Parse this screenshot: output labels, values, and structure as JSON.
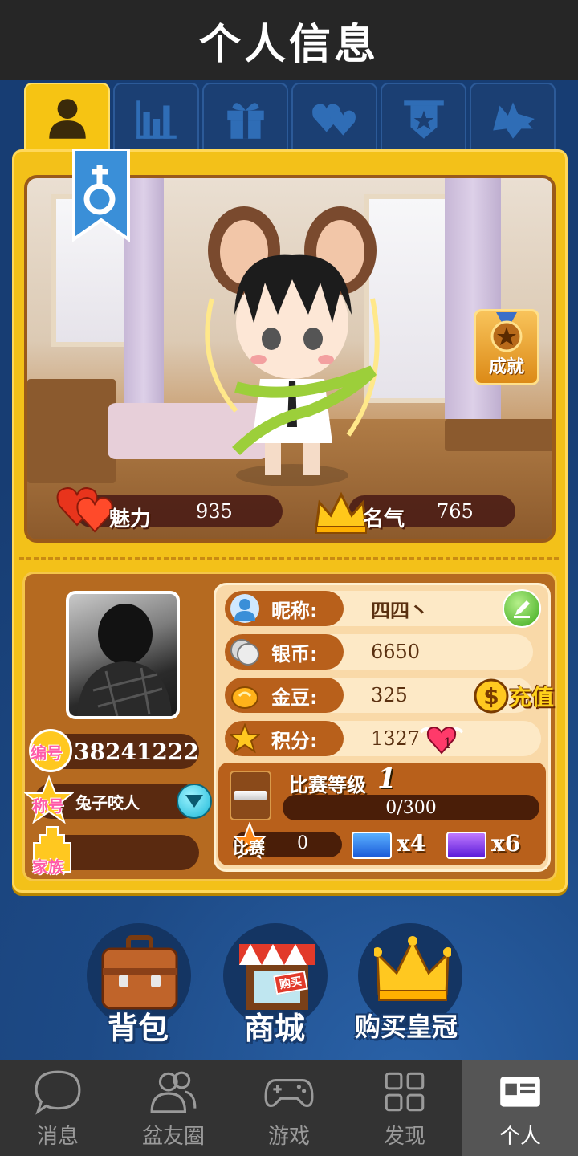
{
  "header": {
    "title": "个人信息"
  },
  "tabs": [
    {
      "icon": "person-icon",
      "active": true
    },
    {
      "icon": "bar-chart-icon",
      "active": false
    },
    {
      "icon": "gift-icon",
      "active": false
    },
    {
      "icon": "hearts-icon",
      "active": false
    },
    {
      "icon": "shield-star-icon",
      "active": false
    },
    {
      "icon": "wolf-icon",
      "active": false
    }
  ],
  "profile": {
    "gender": "male",
    "achievement_label": "成就",
    "charm_label": "魅力",
    "charm_value": "935",
    "fame_label": "名气",
    "fame_value": "765"
  },
  "identity": {
    "id_badge": "编号",
    "id_value": "38241222",
    "title_badge": "称号",
    "title_value": "兔子咬人",
    "family_badge": "家族",
    "family_value": ""
  },
  "info": {
    "nickname_label": "昵称:",
    "nickname_value": "四四丶",
    "silver_label": "银币:",
    "silver_value": "6650",
    "bean_label": "金豆:",
    "bean_value": "325",
    "recharge_label": "充值",
    "points_label": "积分:",
    "points_value": "1327",
    "hearts_count": "1",
    "match_level_label": "比赛等级",
    "match_level_value": "1",
    "progress_text": "0/300",
    "progress_fraction": 0,
    "match_label": "比赛",
    "match_value": "0",
    "ticket_blue_count": "x4",
    "ticket_purple_count": "x6"
  },
  "actions": {
    "bag_label": "背包",
    "shop_label": "商城",
    "shop_tag": "购买",
    "crown_label": "购买皇冠"
  },
  "nav": [
    {
      "label": "消息",
      "icon": "chat-bubble-icon",
      "active": false
    },
    {
      "label": "盆友圈",
      "icon": "friends-icon",
      "active": false
    },
    {
      "label": "游戏",
      "icon": "gamepad-icon",
      "active": false
    },
    {
      "label": "发现",
      "icon": "grid-icon",
      "active": false
    },
    {
      "label": "个人",
      "icon": "id-card-icon",
      "active": true
    }
  ],
  "colors": {
    "panel": "#f3c119",
    "accent": "#b8601b",
    "bg": "#1d4a86",
    "nav": "#333333"
  }
}
